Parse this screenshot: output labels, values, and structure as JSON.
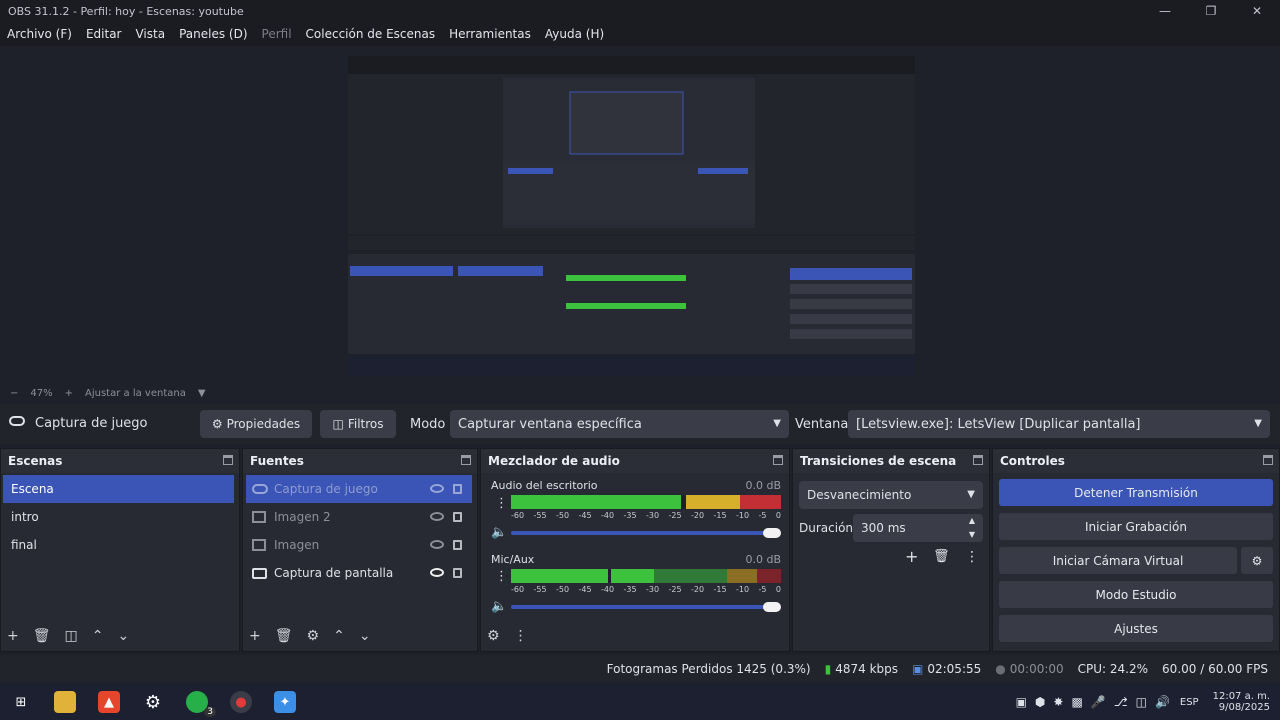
{
  "window": {
    "title": "OBS 31.1.2 - Perfil: hoy - Escenas: youtube"
  },
  "menu": [
    "Archivo (F)",
    "Editar",
    "Vista",
    "Paneles (D)",
    "Perfil",
    "Colección de Escenas",
    "Herramientas",
    "Ayuda (H)"
  ],
  "zoom": {
    "level": "47%",
    "fit_label": "Ajustar a la ventana"
  },
  "source_bar": {
    "source_name": "Captura de juego",
    "properties_label": "Propiedades",
    "filters_label": "Filtros",
    "mode_label": "Modo",
    "mode_value": "Capturar ventana específica",
    "window_label": "Ventana",
    "window_value": "[Letsview.exe]: LetsView [Duplicar pantalla]"
  },
  "scenes": {
    "title": "Escenas",
    "items": [
      "Escena",
      "intro",
      "final"
    ]
  },
  "sources": {
    "title": "Fuentes",
    "items": [
      "Captura de juego",
      "Imagen 2",
      "Imagen",
      "Captura de pantalla"
    ]
  },
  "mixer": {
    "title": "Mezclador de audio",
    "channels": [
      {
        "name": "Audio del escritorio",
        "level": "0.0 dB"
      },
      {
        "name": "Mic/Aux",
        "level": "0.0 dB"
      }
    ],
    "ticks": [
      "-60",
      "-55",
      "-50",
      "-45",
      "-40",
      "-35",
      "-30",
      "-25",
      "-20",
      "-15",
      "-10",
      "-5",
      "0"
    ]
  },
  "transitions": {
    "title": "Transiciones de escena",
    "type": "Desvanecimiento",
    "duration_label": "Duración",
    "duration_value": "300 ms"
  },
  "controls": {
    "title": "Controles",
    "stop_stream": "Detener Transmisión",
    "start_recording": "Iniciar Grabación",
    "virtual_cam": "Iniciar Cámara Virtual",
    "studio_mode": "Modo Estudio",
    "settings": "Ajustes"
  },
  "status": {
    "dropped_frames": "Fotogramas Perdidos 1425 (0.3%)",
    "bitrate": "4874 kbps",
    "stream_time": "02:05:55",
    "record_time": "00:00:00",
    "cpu": "CPU: 24.2%",
    "fps": "60.00 / 60.00 FPS"
  },
  "taskbar": {
    "lang": "ESP",
    "time": "12:07 a. m.",
    "date": "9/08/2025",
    "badge": "3"
  },
  "colors": {
    "accent": "#3b55b6",
    "meter_green": "#3cc23c",
    "meter_yellow": "#d6b02a",
    "meter_red": "#c42f36"
  }
}
